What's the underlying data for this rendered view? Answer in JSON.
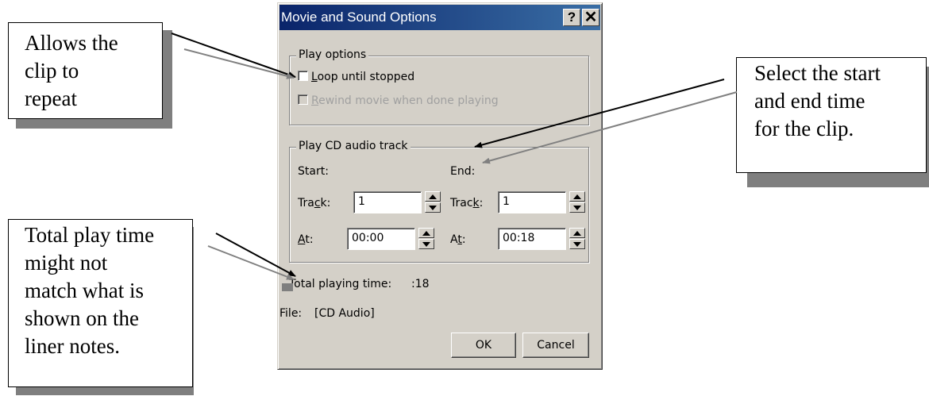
{
  "callouts": {
    "loop": [
      "Allows the",
      "clip to",
      "repeat"
    ],
    "time": [
      "Select the start",
      "and end time",
      "for the clip."
    ],
    "total": [
      "Total play time",
      "might not",
      "match what is",
      "shown on the",
      "liner notes."
    ]
  },
  "dialog": {
    "title": "Movie and Sound Options",
    "help_label": "?",
    "close_label": "✕",
    "play_options": {
      "legend": "Play options",
      "loop": {
        "accel": "L",
        "rest": "oop until stopped",
        "checked": false
      },
      "rewind": {
        "accel": "R",
        "rest": "ewind movie when done playing",
        "checked": false,
        "disabled": true
      }
    },
    "cd_track": {
      "legend": "Play CD audio track",
      "start_label": "Start:",
      "end_label": "End:",
      "start_track_label": {
        "pre": "Tra",
        "accel": "c",
        "post": "k:"
      },
      "end_track_label": {
        "pre": "Trac",
        "accel": "k",
        "post": ":"
      },
      "start_at_label": {
        "pre": "",
        "accel": "A",
        "post": "t:"
      },
      "end_at_label": {
        "pre": "A",
        "accel": "t",
        "post": ":"
      },
      "start_track": "1",
      "end_track": "1",
      "start_at": "00:00",
      "end_at": "00:18"
    },
    "total_time_label": "Total playing time:",
    "total_time_value": ":18",
    "file_label": "File:",
    "file_value": "[CD Audio]",
    "ok_label": "OK",
    "cancel_label": "Cancel"
  },
  "colors": {
    "dialog_face": "#d4d0c8",
    "title_gradient_start": "#0a246a",
    "title_gradient_end": "#3a6ea5",
    "callout_shadow": "#7f7f7f",
    "arrow_dark": "#000000",
    "arrow_light": "#808080"
  }
}
